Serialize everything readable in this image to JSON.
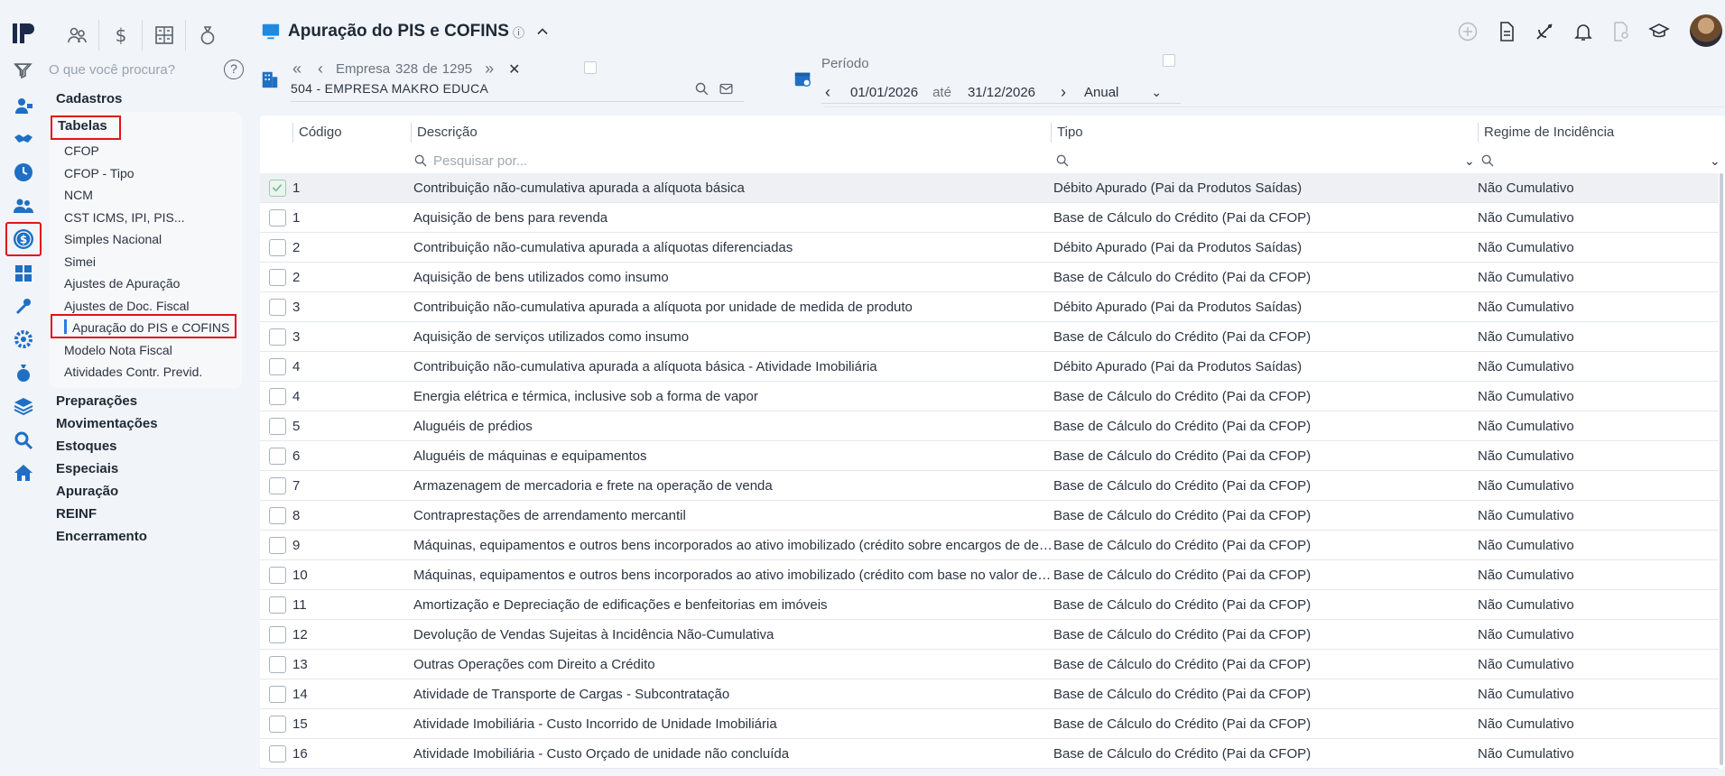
{
  "app": {
    "search_placeholder": "O que você procura?",
    "help_label": "?"
  },
  "menu": {
    "cadastros": "Cadastros",
    "tabelas": "Tabelas",
    "tabelas_items": [
      "CFOP",
      "CFOP - Tipo",
      "NCM",
      "CST ICMS, IPI, PIS...",
      "Simples Nacional",
      "Simei",
      "Ajustes de Apuração",
      "Ajustes de Doc. Fiscal",
      "Apuração do PIS e COFINS",
      "Modelo Nota Fiscal",
      "Atividades Contr. Previd."
    ],
    "sections": [
      "Preparações",
      "Movimentações",
      "Estoques",
      "Especiais",
      "Apuração",
      "REINF",
      "Encerramento"
    ]
  },
  "page": {
    "title": "Apuração do PIS e COFINS",
    "info_icon": "ⓘ"
  },
  "empresa": {
    "label": "Empresa",
    "current": "328",
    "of_label": "de",
    "total": "1295",
    "name": "504 - EMPRESA MAKRO EDUCA"
  },
  "periodo": {
    "label": "Período",
    "start": "01/01/2026",
    "until_label": "até",
    "end": "31/12/2026",
    "mode": "Anual"
  },
  "table": {
    "columns": [
      "Código",
      "Descrição",
      "Tipo",
      "Regime de Incidência"
    ],
    "filter_placeholder": "Pesquisar por...",
    "rows": [
      {
        "code": "1",
        "desc": "Contribuição não-cumulativa apurada a alíquota básica",
        "tipo": "Débito Apurado (Pai da Produtos Saídas)",
        "regime": "Não Cumulativo",
        "selected": true
      },
      {
        "code": "1",
        "desc": "Aquisição de bens para revenda",
        "tipo": "Base de Cálculo do Crédito (Pai da CFOP)",
        "regime": "Não Cumulativo"
      },
      {
        "code": "2",
        "desc": "Contribuição não-cumulativa apurada a alíquotas diferenciadas",
        "tipo": "Débito Apurado (Pai da Produtos Saídas)",
        "regime": "Não Cumulativo"
      },
      {
        "code": "2",
        "desc": "Aquisição de bens utilizados como insumo",
        "tipo": "Base de Cálculo do Crédito (Pai da CFOP)",
        "regime": "Não Cumulativo"
      },
      {
        "code": "3",
        "desc": "Contribuição não-cumulativa apurada a alíquota por unidade de medida de produto",
        "tipo": "Débito Apurado (Pai da Produtos Saídas)",
        "regime": "Não Cumulativo"
      },
      {
        "code": "3",
        "desc": "Aquisição de serviços utilizados como insumo",
        "tipo": "Base de Cálculo do Crédito (Pai da CFOP)",
        "regime": "Não Cumulativo"
      },
      {
        "code": "4",
        "desc": "Contribuição não-cumulativa apurada a alíquota básica - Atividade Imobiliária",
        "tipo": "Débito Apurado (Pai da Produtos Saídas)",
        "regime": "Não Cumulativo"
      },
      {
        "code": "4",
        "desc": "Energia elétrica e térmica, inclusive sob a forma de vapor",
        "tipo": "Base de Cálculo do Crédito (Pai da CFOP)",
        "regime": "Não Cumulativo"
      },
      {
        "code": "5",
        "desc": "Aluguéis de prédios",
        "tipo": "Base de Cálculo do Crédito (Pai da CFOP)",
        "regime": "Não Cumulativo"
      },
      {
        "code": "6",
        "desc": "Aluguéis de máquinas e equipamentos",
        "tipo": "Base de Cálculo do Crédito (Pai da CFOP)",
        "regime": "Não Cumulativo"
      },
      {
        "code": "7",
        "desc": "Armazenagem de mercadoria e frete na operação de venda",
        "tipo": "Base de Cálculo do Crédito (Pai da CFOP)",
        "regime": "Não Cumulativo"
      },
      {
        "code": "8",
        "desc": "Contraprestações de arrendamento mercantil",
        "tipo": "Base de Cálculo do Crédito (Pai da CFOP)",
        "regime": "Não Cumulativo"
      },
      {
        "code": "9",
        "desc": "Máquinas, equipamentos e outros bens incorporados ao ativo imobilizado (crédito sobre encargos de depreciação)",
        "tipo": "Base de Cálculo do Crédito (Pai da CFOP)",
        "regime": "Não Cumulativo"
      },
      {
        "code": "10",
        "desc": "Máquinas, equipamentos e outros bens incorporados ao ativo imobilizado (crédito com base no valor de aquisição)",
        "tipo": "Base de Cálculo do Crédito (Pai da CFOP)",
        "regime": "Não Cumulativo"
      },
      {
        "code": "11",
        "desc": "Amortização e Depreciação de edificações e benfeitorias em imóveis",
        "tipo": "Base de Cálculo do Crédito (Pai da CFOP)",
        "regime": "Não Cumulativo"
      },
      {
        "code": "12",
        "desc": "Devolução de Vendas Sujeitas à Incidência Não-Cumulativa",
        "tipo": "Base de Cálculo do Crédito (Pai da CFOP)",
        "regime": "Não Cumulativo"
      },
      {
        "code": "13",
        "desc": "Outras Operações com Direito a Crédito",
        "tipo": "Base de Cálculo do Crédito (Pai da CFOP)",
        "regime": "Não Cumulativo"
      },
      {
        "code": "14",
        "desc": "Atividade de Transporte de Cargas - Subcontratação",
        "tipo": "Base de Cálculo do Crédito (Pai da CFOP)",
        "regime": "Não Cumulativo"
      },
      {
        "code": "15",
        "desc": "Atividade Imobiliária - Custo Incorrido de Unidade Imobiliária",
        "tipo": "Base de Cálculo do Crédito (Pai da CFOP)",
        "regime": "Não Cumulativo"
      },
      {
        "code": "16",
        "desc": "Atividade Imobiliária - Custo Orçado de unidade não concluída",
        "tipo": "Base de Cálculo do Crédito (Pai da CFOP)",
        "regime": "Não Cumulativo"
      }
    ]
  },
  "colors": {
    "accent": "#2c7be5",
    "highlight_box": "#e0141b",
    "rail_icon": "#1f6fc4"
  }
}
